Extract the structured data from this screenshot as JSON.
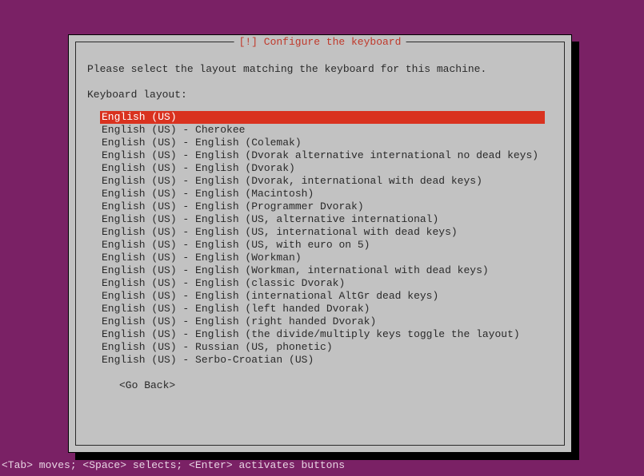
{
  "dialog": {
    "title": "[!] Configure the keyboard",
    "prompt": "Please select the layout matching the keyboard for this machine.",
    "label": "Keyboard layout:",
    "go_back": "<Go Back>"
  },
  "layouts": [
    {
      "label": "English (US)",
      "selected": true
    },
    {
      "label": "English (US) - Cherokee",
      "selected": false
    },
    {
      "label": "English (US) - English (Colemak)",
      "selected": false
    },
    {
      "label": "English (US) - English (Dvorak alternative international no dead keys)",
      "selected": false
    },
    {
      "label": "English (US) - English (Dvorak)",
      "selected": false
    },
    {
      "label": "English (US) - English (Dvorak, international with dead keys)",
      "selected": false
    },
    {
      "label": "English (US) - English (Macintosh)",
      "selected": false
    },
    {
      "label": "English (US) - English (Programmer Dvorak)",
      "selected": false
    },
    {
      "label": "English (US) - English (US, alternative international)",
      "selected": false
    },
    {
      "label": "English (US) - English (US, international with dead keys)",
      "selected": false
    },
    {
      "label": "English (US) - English (US, with euro on 5)",
      "selected": false
    },
    {
      "label": "English (US) - English (Workman)",
      "selected": false
    },
    {
      "label": "English (US) - English (Workman, international with dead keys)",
      "selected": false
    },
    {
      "label": "English (US) - English (classic Dvorak)",
      "selected": false
    },
    {
      "label": "English (US) - English (international AltGr dead keys)",
      "selected": false
    },
    {
      "label": "English (US) - English (left handed Dvorak)",
      "selected": false
    },
    {
      "label": "English (US) - English (right handed Dvorak)",
      "selected": false
    },
    {
      "label": "English (US) - English (the divide/multiply keys toggle the layout)",
      "selected": false
    },
    {
      "label": "English (US) - Russian (US, phonetic)",
      "selected": false
    },
    {
      "label": "English (US) - Serbo-Croatian (US)",
      "selected": false
    }
  ],
  "footer": "<Tab> moves; <Space> selects; <Enter> activates buttons"
}
